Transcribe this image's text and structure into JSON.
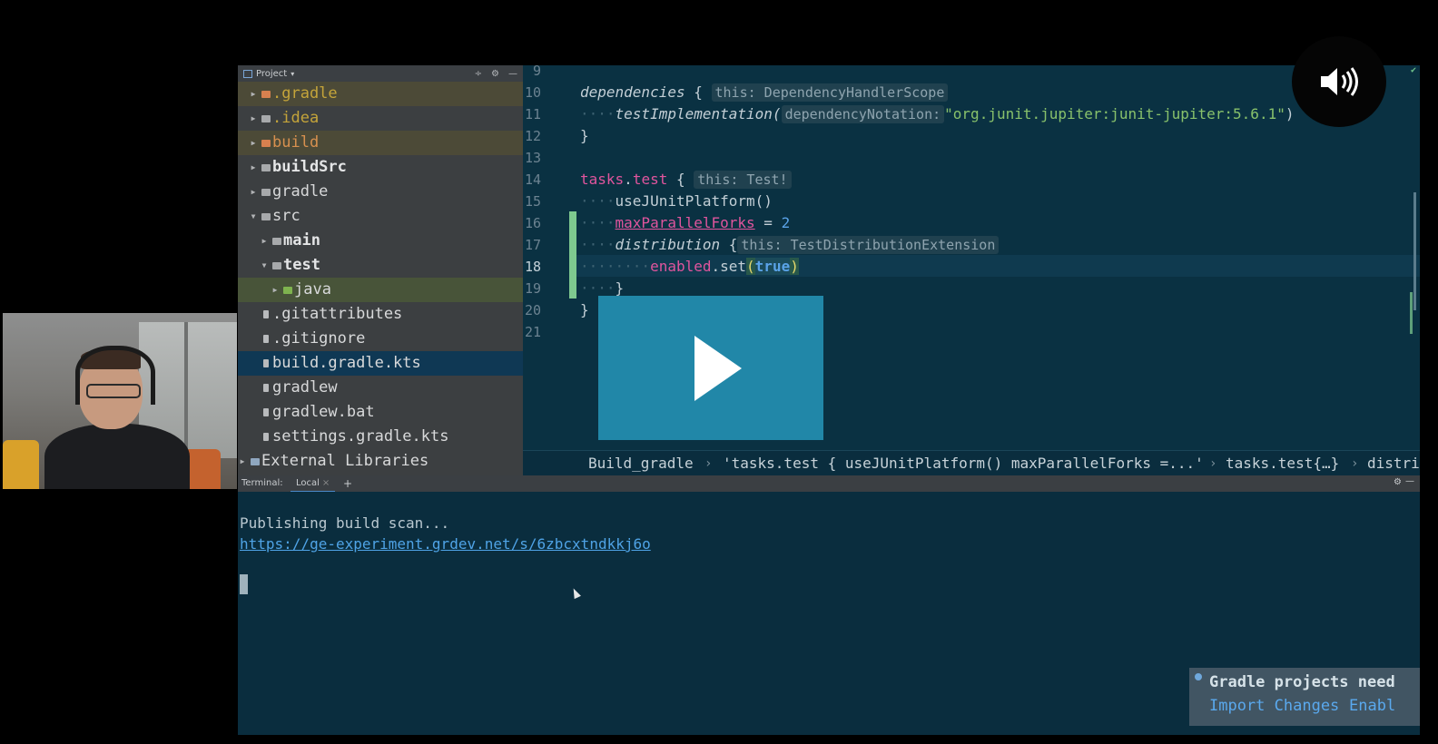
{
  "project_panel": {
    "title": "Project",
    "tree": [
      {
        "label": ".gradle",
        "style": "yellow",
        "icon": "folder-orange-icon"
      },
      {
        "label": ".idea",
        "style": "yellow",
        "icon": "folder-icon"
      },
      {
        "label": "build",
        "style": "orange",
        "icon": "folder-orange-icon"
      },
      {
        "label": "buildSrc",
        "style": "bold",
        "icon": "module-folder-icon"
      },
      {
        "label": "gradle",
        "style": "normal",
        "icon": "folder-icon"
      },
      {
        "label": "src",
        "style": "normal",
        "icon": "folder-icon"
      },
      {
        "label": "main",
        "style": "bold",
        "icon": "module-folder-icon"
      },
      {
        "label": "test",
        "style": "bold",
        "icon": "module-folder-icon"
      },
      {
        "label": "java",
        "style": "normal",
        "icon": "test-source-folder-icon"
      },
      {
        "label": ".gitattributes",
        "style": "normal",
        "icon": "file-icon"
      },
      {
        "label": ".gitignore",
        "style": "normal",
        "icon": "file-icon"
      },
      {
        "label": "build.gradle.kts",
        "style": "normal",
        "icon": "gradle-file-icon"
      },
      {
        "label": "gradlew",
        "style": "normal",
        "icon": "file-icon"
      },
      {
        "label": "gradlew.bat",
        "style": "normal",
        "icon": "file-icon"
      },
      {
        "label": "settings.gradle.kts",
        "style": "normal",
        "icon": "gradle-file-icon"
      },
      {
        "label": "External Libraries",
        "style": "normal",
        "icon": "library-icon"
      }
    ]
  },
  "editor": {
    "line_numbers": [
      "9",
      "10",
      "11",
      "12",
      "13",
      "14",
      "15",
      "16",
      "17",
      "18",
      "19",
      "20",
      "21"
    ],
    "active_line": "18",
    "code": {
      "l10_kw": "dependencies",
      "l10_brace": " {",
      "l10_hint": "this: DependencyHandlerScope",
      "l11_indent": "····",
      "l11_fn": "testImplementation(",
      "l11_hint": "dependencyNotation:",
      "l11_str": "\"org.junit.jupiter:junit-jupiter:5.6.1\"",
      "l11_close": ")",
      "l12": "}",
      "l14_a": "tasks",
      "l14_dot": ".",
      "l14_b": "test",
      "l14_brace": " {",
      "l14_hint": "this: Test!",
      "l15_indent": "····",
      "l15_code": "useJUnitPlatform()",
      "l16_indent": "····",
      "l16_prop": "maxParallelForks",
      "l16_eq": " = ",
      "l16_num": "2",
      "l17_indent": "····",
      "l17_kw": "distribution",
      "l17_brace": " {",
      "l17_hint": "this: TestDistributionExtension",
      "l18_indent": "········",
      "l18_prop": "enabled",
      "l18_set": ".set",
      "l18_open": "(",
      "l18_bool": "true",
      "l18_close": ")",
      "l19_indent": "····",
      "l19": "}",
      "l20": "}"
    }
  },
  "breadcrumb": {
    "items": [
      "Build_gradle",
      "'tasks.test { useJUnitPlatform() maxParallelForks =...'",
      "tasks.test{…}",
      "distri"
    ],
    "separator": "›"
  },
  "terminal": {
    "title": "Terminal:",
    "tab_label": "Local",
    "tab_close": "×",
    "add": "+",
    "lines": [
      "Publishing build scan...",
      "https://ge-experiment.grdev.net/s/6zbcxtndkkj6o"
    ]
  },
  "notification": {
    "title": "Gradle projects need",
    "link_import": "Import Changes",
    "link_enable": "Enabl"
  },
  "colors": {
    "editor_bg": "#0a3142",
    "accent_pink": "#e0559d",
    "accent_blue": "#5aa3e8",
    "string_green": "#88c16b",
    "play_overlay": "#2187a8"
  }
}
